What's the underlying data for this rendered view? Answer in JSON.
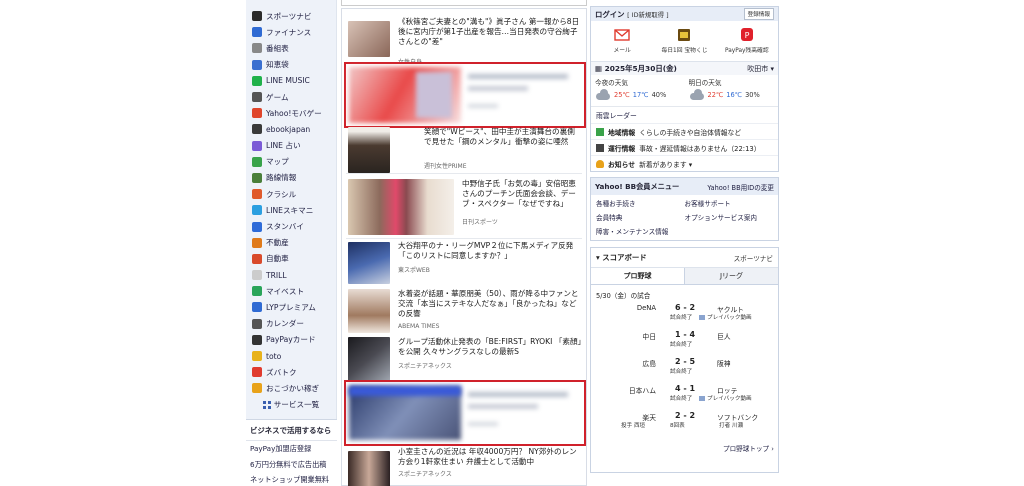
{
  "sidebar": {
    "items": [
      {
        "label": "スポーツナビ",
        "color": "#2b2b2b"
      },
      {
        "label": "ファイナンス",
        "color": "#2f6ad3"
      },
      {
        "label": "番組表",
        "color": "#888888"
      },
      {
        "label": "知恵袋",
        "color": "#3a6fd0"
      },
      {
        "label": "LINE MUSIC",
        "color": "#20b14a"
      },
      {
        "label": "ゲーム",
        "color": "#555555"
      },
      {
        "label": "Yahoo!モバゲー",
        "color": "#e0452b"
      },
      {
        "label": "ebookjapan",
        "color": "#3a3a3a"
      },
      {
        "label": "LINE 占い",
        "color": "#7b5bd6"
      },
      {
        "label": "マップ",
        "color": "#39a34a"
      },
      {
        "label": "路線情報",
        "color": "#4a7f3a"
      },
      {
        "label": "クラシル",
        "color": "#e05a2b"
      },
      {
        "label": "LINEスキマニ",
        "color": "#2c9fe0"
      },
      {
        "label": "スタンバイ",
        "color": "#2e6bd8"
      },
      {
        "label": "不動産",
        "color": "#e07a1a"
      },
      {
        "label": "自動車",
        "color": "#d94a2b"
      },
      {
        "label": "TRILL",
        "color": "#cccccc"
      },
      {
        "label": "マイベスト",
        "color": "#2aa55a"
      },
      {
        "label": "LYPプレミアム",
        "color": "#2f6ad3"
      },
      {
        "label": "カレンダー",
        "color": "#555555"
      },
      {
        "label": "PayPayカード",
        "color": "#333333"
      },
      {
        "label": "toto",
        "color": "#e8b21a"
      },
      {
        "label": "ズバトク",
        "color": "#e03b2f"
      },
      {
        "label": "おこづかい稼ぎ",
        "color": "#e8a21a"
      }
    ],
    "more_label": "サービス一覧",
    "biz": {
      "title": "ビジネスで活用するなら",
      "links": [
        "PayPay加盟店登録",
        "6万円分無料で広告出稿",
        "ネットショップ開業無料"
      ]
    }
  },
  "news": {
    "items": [
      {
        "title": "《秋篠宮ご夫妻との\"溝も\"》眞子さん 第一報から8日後に宮内庁が第1子出産を報告…当日発表の守谷絢子さんとの\"差\"",
        "source": "女性自身",
        "thumb": "#a8786a"
      },
      {
        "title": "笑顔で\"Wピース\"、田中圭が主演舞台の裏側で見せた「鋼のメンタル」衝撃の姿に唖然",
        "source": "週刊女性PRIME",
        "thumb": "#5a4638"
      },
      {
        "title": "中野信子氏「お気の毒」安倍昭恵さんのプーチン氏面会会談、デーブ・スペクター「なぜですね」",
        "source": "日刊スポーツ",
        "thumb": "#8a6f64"
      },
      {
        "title": "大谷翔平のナ・リーグMVP２位に下馬メディア反発「このリストに同意しますか？」",
        "source": "東スポWEB",
        "thumb": "#3b4f78"
      },
      {
        "title": "水着姿が話題・華原朋美（50）、雨が降る中ファンと交流「本当にステキな人だなぁ」「良かったね」などの反響",
        "source": "ABEMA TIMES",
        "thumb": "#b89a86"
      },
      {
        "title": "グループ活動休止発表の「BE:FIRST」RYOKI 「素顔」を公開 久々サングラスなしの最新S",
        "source": "スポニチアネックス",
        "thumb": "#2f2f33"
      },
      {
        "title": "小室圭さんの近況は 年収4000万円？ NY郊外のレン方会り1軒家住まい 弁護士として活動中",
        "source": "スポニチアネックス",
        "thumb": "#6a5048"
      }
    ]
  },
  "login": {
    "title": "ログイン",
    "sub": "[ ID新規取得 ]",
    "button": "登録情報",
    "quick": [
      {
        "label": "メール",
        "icon": "mail-icon",
        "color": "#e03b2f"
      },
      {
        "label": "毎日1回 宝物くじ",
        "icon": "lottery-icon",
        "color": "#b8901a"
      },
      {
        "label": "PayPay残高確認",
        "icon": "paypay-icon",
        "color": "#e0212b"
      }
    ]
  },
  "weather": {
    "date": "2025年5月30日(金)",
    "location": "吹田市",
    "today_label": "今夜の天気",
    "tomorrow_label": "明日の天気",
    "today": {
      "hi": "25℃",
      "lo": "17℃",
      "rain": "40%"
    },
    "tomorrow": {
      "hi": "22℃",
      "lo": "16℃",
      "rain": "30%"
    },
    "radar": "雨雲レーダー"
  },
  "info": [
    {
      "key": "地域情報",
      "text": "くらしの手続きや自治体情報など",
      "color": "#3aa34a"
    },
    {
      "key": "運行情報",
      "text": "事故・遅延情報はありません（22:13）",
      "color": "#333333"
    },
    {
      "key": "お知らせ",
      "text": "新着があります ▾",
      "color": "#e8a21a"
    }
  ],
  "bb": {
    "title": "Yahoo! BB会員メニュー",
    "link": "Yahoo! BB用IDの変更",
    "links": [
      "各種お手続き",
      "お客様サポート",
      "会員特典",
      "オプションサービス案内",
      "障害・メンテナンス情報"
    ]
  },
  "score": {
    "title": "▾ スコアボード",
    "source": "スポーツナビ",
    "tabs": [
      "プロ野球",
      "Jリーグ"
    ],
    "date": "5/30（金）の試合",
    "video_label": "プレイバック動画",
    "games": [
      {
        "home": "DeNA",
        "score": "6 - 2",
        "away": "ヤクルト",
        "status": "試合終了",
        "video": true
      },
      {
        "home": "中日",
        "score": "1 - 4",
        "away": "巨人",
        "status": "試合終了",
        "video": false
      },
      {
        "home": "広島",
        "score": "2 - 5",
        "away": "阪神",
        "status": "試合終了",
        "video": false
      },
      {
        "home": "日本ハム",
        "score": "4 - 1",
        "away": "ロッテ",
        "status": "試合終了",
        "video": true
      },
      {
        "home": "楽天",
        "score": "2 - 2",
        "away": "ソフトバンク",
        "status": "8回表",
        "video": false,
        "home_pitcher": "投手 西垣",
        "away_pitcher": "打者 川瀬"
      }
    ],
    "more": "プロ野球トップ"
  }
}
